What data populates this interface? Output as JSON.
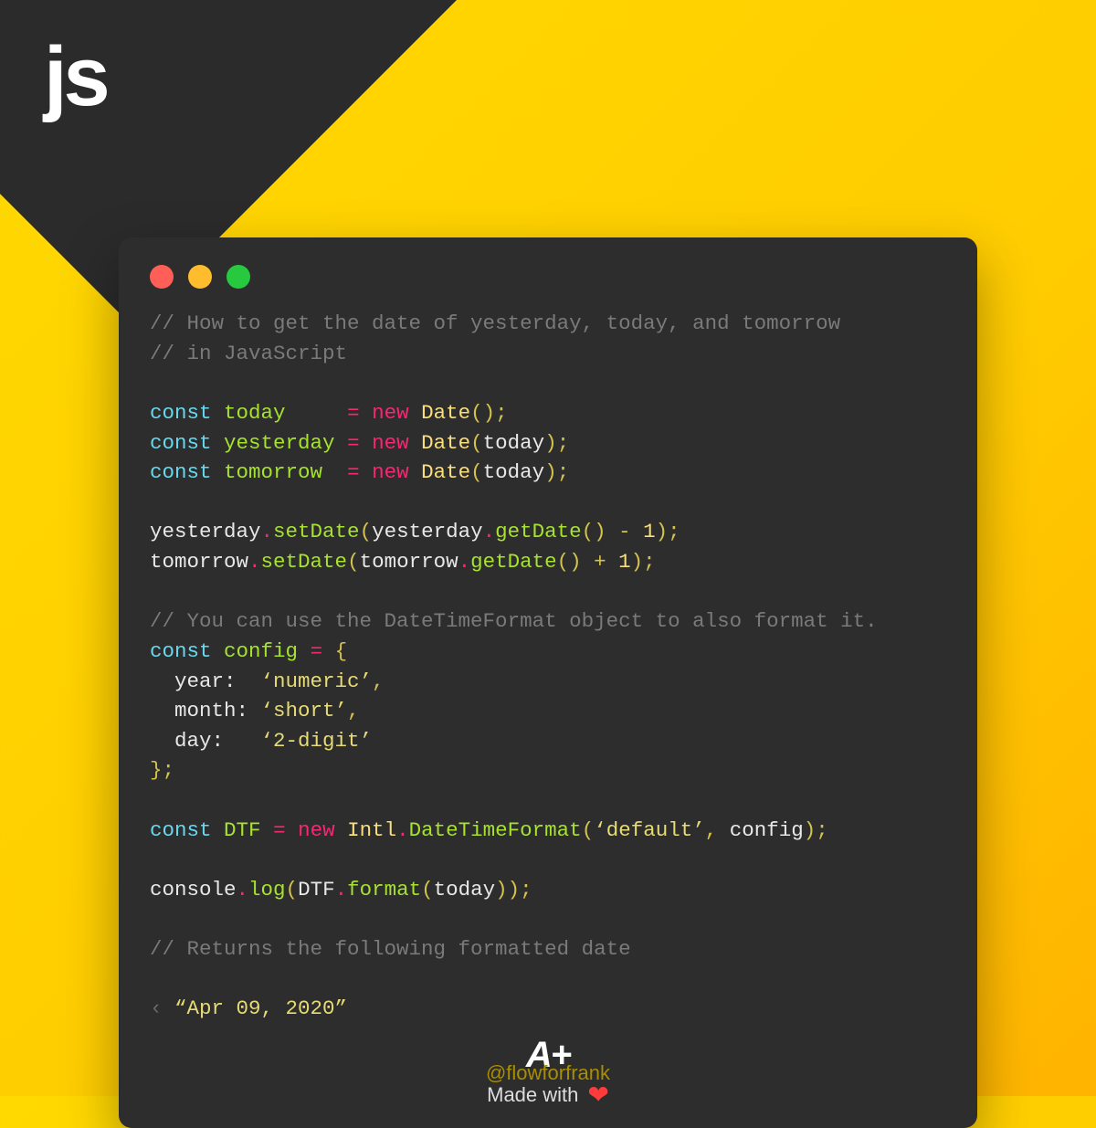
{
  "logo": "js",
  "code": {
    "c1": "// How to get the date of yesterday, today, and tomorrow",
    "c2": "// in JavaScript",
    "l1_kw": "const",
    "l1_nm": "today",
    "l1_eq": "=",
    "l1_new": "new",
    "l1_cls": "Date",
    "l1_end": "();",
    "l2_kw": "const",
    "l2_nm": "yesterday",
    "l2_eq": "=",
    "l2_new": "new",
    "l2_cls": "Date",
    "l2_arg": "today",
    "l2_end": ");",
    "l3_kw": "const",
    "l3_nm": "tomorrow",
    "l3_eq": "=",
    "l3_new": "new",
    "l3_cls": "Date",
    "l3_arg": "today",
    "l3_end": ");",
    "l4_a": "yesterday",
    "l4_b": "setDate",
    "l4_c": "yesterday",
    "l4_d": "getDate",
    "l4_e": "() - ",
    "l4_f": "1",
    "l4_g": ");",
    "l5_a": "tomorrow",
    "l5_b": "setDate",
    "l5_c": "tomorrow",
    "l5_d": "getDate",
    "l5_e": "() + ",
    "l5_f": "1",
    "l5_g": ");",
    "c3": "// You can use the DateTimeFormat object to also format it.",
    "l6_kw": "const",
    "l6_nm": "config",
    "l6_eq": "=",
    "l6_br": "{",
    "l7_k": "year:",
    "l7_v": "‘numeric’",
    "l7_c": ",",
    "l8_k": "month:",
    "l8_v": "‘short’",
    "l8_c": ",",
    "l9_k": "day:",
    "l9_v": "‘2-digit’",
    "l10": "};",
    "l11_kw": "const",
    "l11_nm": "DTF",
    "l11_eq": "=",
    "l11_new": "new",
    "l11_cls": "Intl",
    "l11_dot": ".",
    "l11_fn": "DateTimeFormat",
    "l11_s": "‘default’",
    "l11_arg": "config",
    "l11_end": ");",
    "l12_a": "console",
    "l12_b": "log",
    "l12_c": "DTF",
    "l12_d": "format",
    "l12_e": "today",
    "l12_end": "));",
    "c4": "// Returns the following formatted date",
    "out_caret": "‹ ",
    "out": "“Apr 09, 2020”"
  },
  "footer": {
    "logo": "A+",
    "made": "Made with",
    "heart": "❤"
  },
  "handle": "@flowforfrank"
}
